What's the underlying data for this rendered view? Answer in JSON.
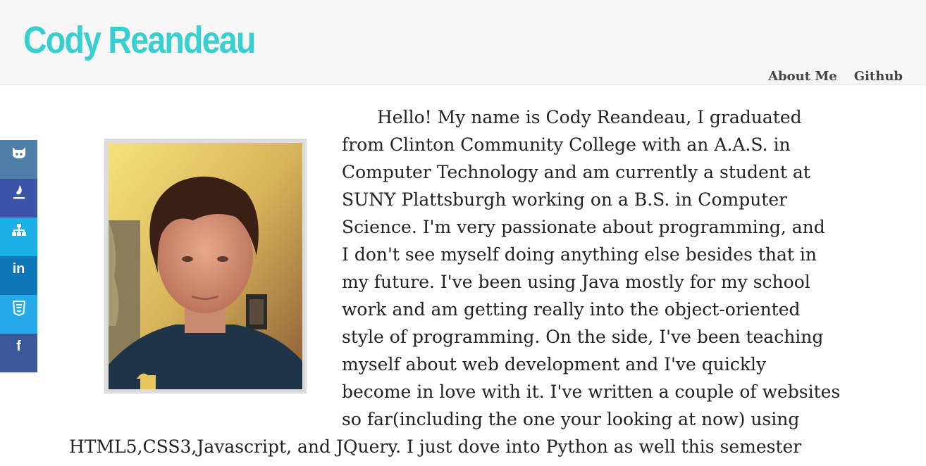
{
  "header": {
    "title": "Cody Reandeau",
    "nav": [
      "About Me",
      "Github"
    ]
  },
  "social": [
    {
      "icon": "github-icon",
      "color": "#4f7fa6"
    },
    {
      "icon": "code-icon",
      "color": "#3a55a7"
    },
    {
      "icon": "sitemap-icon",
      "color": "#1cb0e8"
    },
    {
      "icon": "linkedin-icon",
      "color": "#0e78b6"
    },
    {
      "icon": "html5-icon",
      "color": "#26a9e8"
    },
    {
      "icon": "facebook-icon",
      "color": "#3b5998"
    }
  ],
  "bio": {
    "lines": [
      "Hello! My name is Cody Reandeau, I graduated",
      "from Clinton Community College with an A.A.S. in",
      "Computer Technology and am currently a student at",
      "SUNY Plattsburgh working on a B.S. in Computer",
      "Science. I'm very passionate about programming, and",
      "I don't see myself doing anything else besides that in",
      "my future. I've been using Java mostly for my school",
      "work and am getting really into the object-oriented",
      "style of programming. On the side, I've been teaching",
      "myself about web development and I've quickly",
      "become in love with it. I've written a couple of websites",
      "so far(including the one your looking at now) using",
      "HTML5,CSS3,Javascript, and JQuery. I just dove into Python as well this semester"
    ]
  },
  "colors": {
    "title": "#38cfd0",
    "header_bg": "#f7f7f7"
  }
}
